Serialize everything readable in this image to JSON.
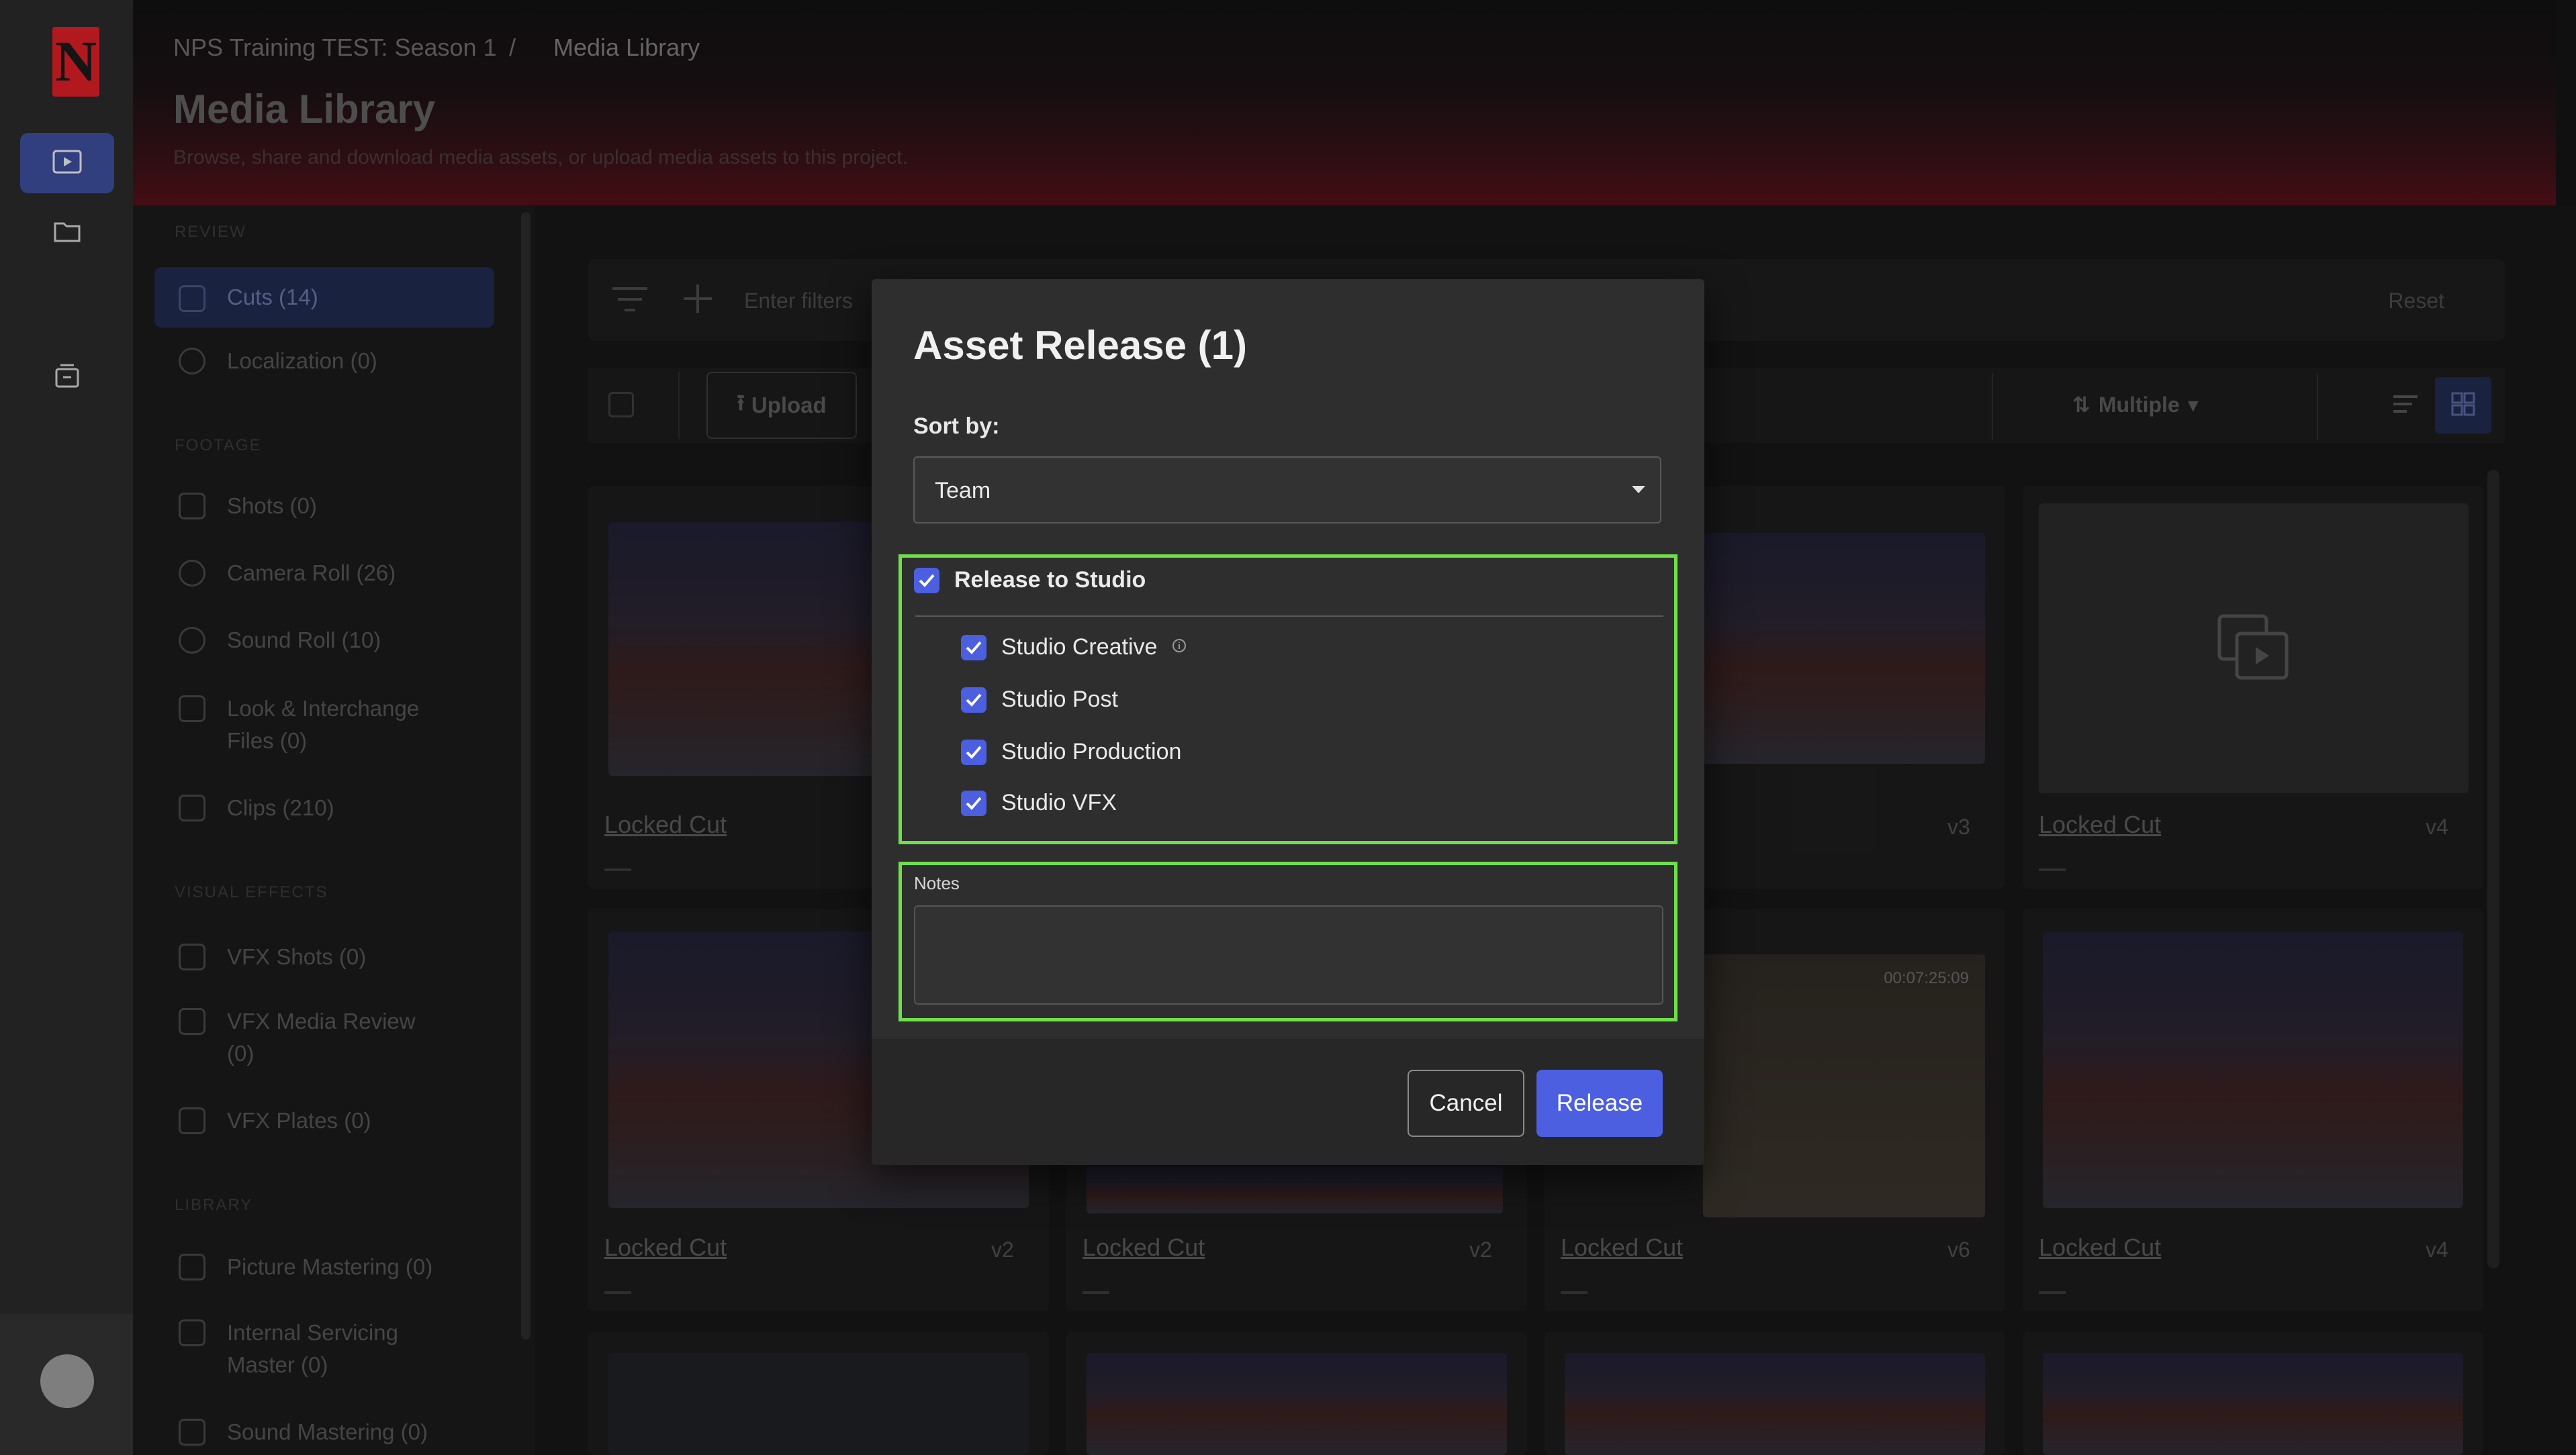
{
  "rail": {
    "logo_letter": "N",
    "icons": [
      "media-library-icon",
      "folder-icon",
      "releases-icon"
    ]
  },
  "header": {
    "breadcrumb_project": "NPS Training TEST: Season 1",
    "breadcrumb_sep": "/",
    "breadcrumb_current": "Media Library",
    "title": "Media Library",
    "subtitle": "Browse, share and download media assets, or upload media assets to this project."
  },
  "sidebar": {
    "sections": {
      "review": "REVIEW",
      "footage": "FOOTAGE",
      "visual_effects": "VISUAL EFFECTS",
      "library": "LIBRARY"
    },
    "items": {
      "cuts": "Cuts (14)",
      "localization": "Localization (0)",
      "shots": "Shots (0)",
      "camera_roll": "Camera Roll (26)",
      "sound_roll": "Sound Roll (10)",
      "look": "Look & Interchange Files (0)",
      "clips": "Clips (210)",
      "vfx_shots": "VFX Shots (0)",
      "vfx_media_review": "VFX Media Review (0)",
      "vfx_plates": "VFX Plates (0)",
      "picture_mastering": "Picture Mastering (0)",
      "internal_servicing": "Internal Servicing Master (0)",
      "sound_mastering": "Sound Mastering (0)"
    }
  },
  "main": {
    "filter_placeholder": "Enter filters",
    "reset": "Reset",
    "upload": "Upload",
    "sort": "Multiple",
    "cards": [
      {
        "label": "Locked Cut",
        "version": ""
      },
      {
        "label": "",
        "version": "v3"
      },
      {
        "label": "Locked Cut",
        "version": "v4"
      },
      {
        "label": "Locked Cut",
        "version": "v2"
      },
      {
        "label": "Locked Cut",
        "version": "v2"
      },
      {
        "label": "Locked Cut",
        "version": "v6"
      },
      {
        "label": "Locked Cut",
        "version": "v4"
      }
    ],
    "timecode": "00:07:25:09"
  },
  "modal": {
    "title": "Asset Release (1)",
    "sort_label": "Sort by:",
    "sort_value": "Team",
    "release_to_studio": "Release to Studio",
    "options": [
      "Studio Creative",
      "Studio Post",
      "Studio Production",
      "Studio VFX"
    ],
    "notes_label": "Notes",
    "notes_value": "",
    "cancel": "Cancel",
    "release": "Release"
  },
  "colors": {
    "accent": "#4c5fe0",
    "highlight_box": "#6fe04a",
    "logo_red": "#e50914"
  }
}
